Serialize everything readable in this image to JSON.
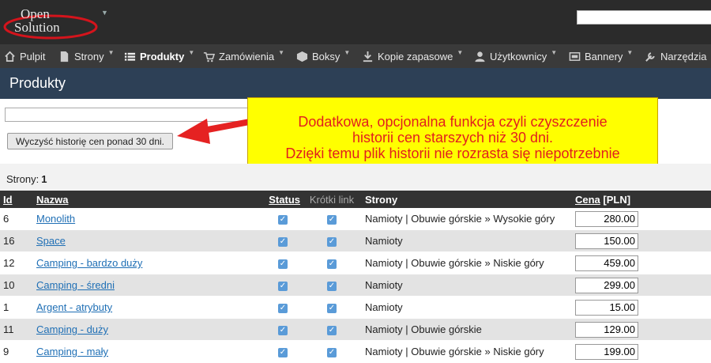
{
  "logo": {
    "line1": "Open",
    "line2": "Solution"
  },
  "search": {
    "value": ""
  },
  "menu": {
    "items": [
      {
        "label": "Pulpit",
        "icon": "home-icon",
        "caret": false
      },
      {
        "label": "Strony",
        "icon": "document-icon",
        "caret": true
      },
      {
        "label": "Produkty",
        "icon": "list-icon",
        "caret": true
      },
      {
        "label": "Zamówienia",
        "icon": "cart-icon",
        "caret": true
      },
      {
        "label": "Boksy",
        "icon": "box-icon",
        "caret": true
      },
      {
        "label": "Kopie zapasowe",
        "icon": "download-icon",
        "caret": true
      },
      {
        "label": "Użytkownicy",
        "icon": "user-icon",
        "caret": true
      },
      {
        "label": "Bannery",
        "icon": "banner-icon",
        "caret": true
      },
      {
        "label": "Narzędzia",
        "icon": "wrench-icon",
        "caret": false
      }
    ]
  },
  "page": {
    "title": "Produkty"
  },
  "filter": {
    "value": ""
  },
  "actions": {
    "clear_history": "Wyczyść historię cen ponad 30 dni."
  },
  "callout": {
    "line1": "Dodatkowa, opcjonalna funkcja czyli czyszczenie",
    "line2": "historii cen starszych niż 30 dni.",
    "line3": "Dzięki temu plik historii nie rozrasta się niepotrzebnie"
  },
  "pager": {
    "label": "Strony:",
    "current": "1"
  },
  "table": {
    "headers": {
      "id": "Id",
      "name": "Nazwa",
      "status": "Status",
      "shortlink": "Krótki link",
      "pages": "Strony",
      "price_link": "Cena",
      "price_unit": "[PLN]"
    },
    "rows": [
      {
        "id": "6",
        "name": "Monolith",
        "status": true,
        "shortlink": true,
        "pages": "Namioty | Obuwie górskie » Wysokie góry",
        "price": "280.00"
      },
      {
        "id": "16",
        "name": "Space",
        "status": true,
        "shortlink": true,
        "pages": "Namioty",
        "price": "150.00"
      },
      {
        "id": "12",
        "name": "Camping - bardzo duży",
        "status": true,
        "shortlink": true,
        "pages": "Namioty | Obuwie górskie » Niskie góry",
        "price": "459.00"
      },
      {
        "id": "10",
        "name": "Camping - średni",
        "status": true,
        "shortlink": true,
        "pages": "Namioty",
        "price": "299.00"
      },
      {
        "id": "1",
        "name": "Argent - atrybuty",
        "status": true,
        "shortlink": true,
        "pages": "Namioty",
        "price": "15.00"
      },
      {
        "id": "11",
        "name": "Camping - duży",
        "status": true,
        "shortlink": true,
        "pages": "Namioty | Obuwie górskie",
        "price": "129.00"
      },
      {
        "id": "9",
        "name": "Camping - mały",
        "status": true,
        "shortlink": true,
        "pages": "Namioty | Obuwie górskie » Niskie góry",
        "price": "199.00"
      }
    ]
  },
  "colors": {
    "topbar": "#2b2b2b",
    "menubar": "#3a3a3a",
    "titlebar": "#2d4056",
    "callout_bg": "#ffff00",
    "callout_text": "#e21e1e",
    "link": "#1f6fb5",
    "checkbox": "#5a9bd8"
  }
}
